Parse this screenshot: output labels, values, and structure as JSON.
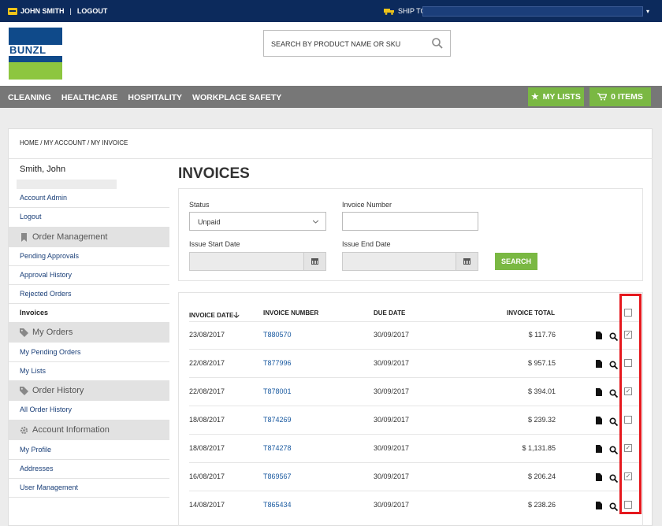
{
  "topbar": {
    "user_name": "JOHN SMITH",
    "separator": "|",
    "logout": "LOGOUT",
    "ship_to_label": "SHIP TO:"
  },
  "brand": {
    "logo_text": "BUNZL",
    "blue": "#0f4a8a",
    "green": "#8dc63f"
  },
  "search": {
    "placeholder": "SEARCH BY PRODUCT NAME OR SKU"
  },
  "nav": {
    "items": [
      "CLEANING",
      "HEALTHCARE",
      "HOSPITALITY",
      "WORKPLACE SAFETY"
    ],
    "my_lists": "MY LISTS",
    "cart": "0 ITEMS"
  },
  "breadcrumb": "HOME / MY ACCOUNT / MY INVOICE",
  "sidebar": {
    "user": "Smith, John",
    "links_top": [
      "Account Admin",
      "Logout"
    ],
    "sections": [
      {
        "title": "Order Management",
        "icon": "bookmark-icon",
        "links": [
          "Pending Approvals",
          "Approval History",
          "Rejected Orders",
          "Invoices"
        ]
      },
      {
        "title": "My Orders",
        "icon": "tag-icon",
        "links": [
          "My Pending Orders",
          "My Lists"
        ]
      },
      {
        "title": "Order History",
        "icon": "tag-icon",
        "links": [
          "All Order History"
        ]
      },
      {
        "title": "Account Information",
        "icon": "gear-icon",
        "links": [
          "My Profile",
          "Addresses",
          "User Management"
        ]
      }
    ]
  },
  "page": {
    "title": "INVOICES"
  },
  "filters": {
    "status_label": "Status",
    "status_value": "Unpaid",
    "invoice_number_label": "Invoice Number",
    "issue_start_label": "Issue Start Date",
    "issue_end_label": "Issue End Date",
    "search_button": "SEARCH"
  },
  "table": {
    "headers": {
      "date": "INVOICE DATE",
      "number": "INVOICE NUMBER",
      "due": "DUE DATE",
      "total": "INVOICE TOTAL"
    },
    "rows": [
      {
        "date": "23/08/2017",
        "number": "T880570",
        "due": "30/09/2017",
        "total": "$ 117.76",
        "checked": true
      },
      {
        "date": "22/08/2017",
        "number": "T877996",
        "due": "30/09/2017",
        "total": "$ 957.15",
        "checked": false
      },
      {
        "date": "22/08/2017",
        "number": "T878001",
        "due": "30/09/2017",
        "total": "$ 394.01",
        "checked": true
      },
      {
        "date": "18/08/2017",
        "number": "T874269",
        "due": "30/09/2017",
        "total": "$ 239.32",
        "checked": false
      },
      {
        "date": "18/08/2017",
        "number": "T874278",
        "due": "30/09/2017",
        "total": "$ 1,131.85",
        "checked": true
      },
      {
        "date": "16/08/2017",
        "number": "T869567",
        "due": "30/09/2017",
        "total": "$ 206.24",
        "checked": true
      },
      {
        "date": "14/08/2017",
        "number": "T865434",
        "due": "30/09/2017",
        "total": "$ 238.26",
        "checked": false
      }
    ]
  },
  "colors": {
    "navy": "#0c2a5c",
    "green": "#7ab843",
    "nav_gray": "#777777",
    "highlight_red": "#e5181e"
  }
}
